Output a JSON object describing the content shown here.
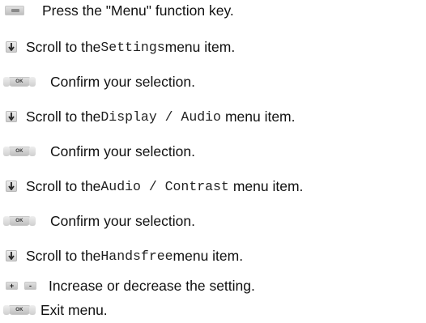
{
  "steps": [
    {
      "icon": "menu-key",
      "parts": [
        "Press the \"Menu\" function key."
      ]
    },
    {
      "icon": "down-arrow-key",
      "parts": [
        "Scroll to the ",
        "Settings",
        " menu item."
      ]
    },
    {
      "icon": "ok-key",
      "ok_label": "OK",
      "parts": [
        "Confirm your selection."
      ]
    },
    {
      "icon": "down-arrow-key",
      "parts": [
        "Scroll to the ",
        "Display / Audio",
        " menu item."
      ]
    },
    {
      "icon": "ok-key",
      "ok_label": "OK",
      "parts": [
        "Confirm your selection."
      ]
    },
    {
      "icon": "down-arrow-key",
      "parts": [
        "Scroll to the ",
        "Audio / Contrast",
        " menu item."
      ]
    },
    {
      "icon": "ok-key",
      "ok_label": "OK",
      "parts": [
        "Confirm your selection."
      ]
    },
    {
      "icon": "down-arrow-key",
      "parts": [
        "Scroll to the ",
        "Handsfree",
        " menu item."
      ]
    },
    {
      "icon": "plus-minus-keys",
      "plus_label": "+",
      "minus_label": "-",
      "parts": [
        "Increase or decrease the setting."
      ]
    },
    {
      "icon": "ok-key",
      "ok_label": "OK",
      "parts": [
        "Exit menu."
      ]
    }
  ]
}
